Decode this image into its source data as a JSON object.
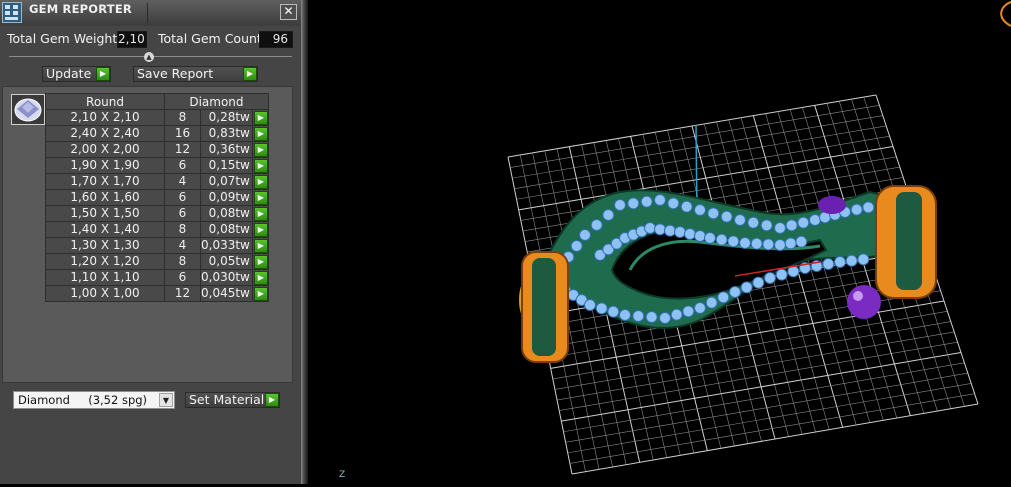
{
  "window": {
    "title": "GEM REPORTER",
    "close_label": "✕"
  },
  "summary": {
    "weight_label": "Total Gem Weight",
    "weight_value": "2,10",
    "count_label": "Total Gem Count",
    "count_value": "96"
  },
  "toolbar": {
    "update_label": "Update",
    "save_label": "Save Report"
  },
  "table": {
    "shape_header": "Round",
    "material_header": "Diamond",
    "rows": [
      {
        "size": "2,10 X 2,10",
        "count": "8",
        "weight": "0,28tw"
      },
      {
        "size": "2,40 X 2,40",
        "count": "16",
        "weight": "0,83tw"
      },
      {
        "size": "2,00 X 2,00",
        "count": "12",
        "weight": "0,36tw"
      },
      {
        "size": "1,90 X 1,90",
        "count": "6",
        "weight": "0,15tw"
      },
      {
        "size": "1,70 X 1,70",
        "count": "4",
        "weight": "0,07tw"
      },
      {
        "size": "1,60 X 1,60",
        "count": "6",
        "weight": "0,09tw"
      },
      {
        "size": "1,50 X 1,50",
        "count": "6",
        "weight": "0,08tw"
      },
      {
        "size": "1,40 X 1,40",
        "count": "8",
        "weight": "0,08tw"
      },
      {
        "size": "1,30 X 1,30",
        "count": "4",
        "weight": "0,033tw"
      },
      {
        "size": "1,20 X 1,20",
        "count": "8",
        "weight": "0,05tw"
      },
      {
        "size": "1,10 X 1,10",
        "count": "6",
        "weight": "0,030tw"
      },
      {
        "size": "1,00 X 1,00",
        "count": "12",
        "weight": "0,045tw"
      }
    ]
  },
  "material": {
    "selected": "Diamond     (3,52 spg)",
    "set_label": "Set Material"
  },
  "viewport": {
    "axis_label": "Z",
    "colors": {
      "background": "#000000",
      "grid": "#bdbdbd",
      "metal": "#1f6b4e",
      "gem": "#8fc2f2",
      "accent_orange": "#e88a1e",
      "amethyst": "#7a2bc2",
      "axis_x": "#d22020",
      "axis_y": "#2aa0c8"
    }
  },
  "icons": [
    "app-icon",
    "close-icon",
    "collapse-icon",
    "play-icon",
    "dropdown-arrow-icon",
    "gem-shape-icon"
  ]
}
